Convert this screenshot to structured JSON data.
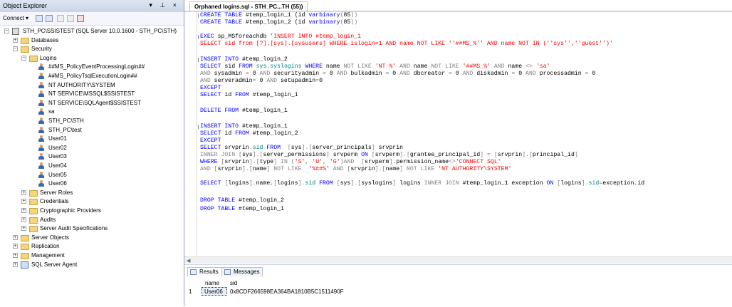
{
  "object_explorer": {
    "title": "Object Explorer",
    "title_buttons": "▾ ⊥ ×",
    "connect_label": "Connect ▾",
    "tree": [
      {
        "label": "STH_PC\\SSISTEST (SQL Server 10.0.1600 - STH_PC\\STH)",
        "icon": "server-icon",
        "expander": "−"
      },
      {
        "label": "Databases",
        "icon": "folder-icon",
        "expander": "+"
      },
      {
        "label": "Security",
        "icon": "folder-icon",
        "expander": "−"
      },
      {
        "label": "Logins",
        "icon": "folder-icon",
        "expander": "−"
      },
      {
        "label": "##MS_PolicyEventProcessingLogin##",
        "icon": "login-icon",
        "expander": ""
      },
      {
        "label": "##MS_PolicyTsqlExecutionLogin##",
        "icon": "login-icon",
        "expander": ""
      },
      {
        "label": "NT AUTHORITY\\SYSTEM",
        "icon": "login-icon",
        "expander": ""
      },
      {
        "label": "NT SERVICE\\MSSQL$SSISTEST",
        "icon": "login-icon",
        "expander": ""
      },
      {
        "label": "NT SERVICE\\SQLAgent$SSISTEST",
        "icon": "login-icon",
        "expander": ""
      },
      {
        "label": "sa",
        "icon": "login-icon",
        "expander": ""
      },
      {
        "label": "STH_PC\\STH",
        "icon": "login-icon",
        "expander": ""
      },
      {
        "label": "STH_PC\\test",
        "icon": "login-icon",
        "expander": ""
      },
      {
        "label": "User01",
        "icon": "login-icon",
        "expander": ""
      },
      {
        "label": "User02",
        "icon": "login-icon",
        "expander": ""
      },
      {
        "label": "User03",
        "icon": "login-icon",
        "expander": ""
      },
      {
        "label": "User04",
        "icon": "login-icon",
        "expander": ""
      },
      {
        "label": "User05",
        "icon": "login-icon",
        "expander": ""
      },
      {
        "label": "User06",
        "icon": "login-icon",
        "expander": ""
      },
      {
        "label": "Server Roles",
        "icon": "folder-icon",
        "expander": "+"
      },
      {
        "label": "Credentials",
        "icon": "folder-icon",
        "expander": "+"
      },
      {
        "label": "Cryptographic Providers",
        "icon": "folder-icon",
        "expander": "+"
      },
      {
        "label": "Audits",
        "icon": "folder-icon",
        "expander": "+"
      },
      {
        "label": "Server Audit Specifications",
        "icon": "folder-icon",
        "expander": "+"
      },
      {
        "label": "Server Objects",
        "icon": "folder-icon",
        "expander": "+"
      },
      {
        "label": "Replication",
        "icon": "folder-icon",
        "expander": "+"
      },
      {
        "label": "Management",
        "icon": "folder-icon",
        "expander": "+"
      },
      {
        "label": "SQL Server Agent",
        "icon": "agent-icon",
        "expander": "+"
      }
    ]
  },
  "editor": {
    "tab_title": "Orphaned logins.sql - STH_PC...TH (55))",
    "lines": [
      [
        [
          "k",
          "CREATE TABLE "
        ],
        [
          "",
          "#temp_login_1 (id "
        ],
        [
          "k",
          "varbinary"
        ],
        [
          "g",
          "("
        ],
        [
          "",
          "85"
        ],
        [
          "g",
          ")"
        ],
        [
          "g",
          ")"
        ]
      ],
      [
        [
          "k",
          "CREATE TABLE "
        ],
        [
          "",
          "#temp_login_2 (id "
        ],
        [
          "k",
          "varbinary"
        ],
        [
          "g",
          "("
        ],
        [
          "",
          "85"
        ],
        [
          "g",
          ")"
        ],
        [
          "g",
          ")"
        ]
      ],
      [],
      [
        [
          "k",
          "EXEC "
        ],
        [
          "",
          "sp_MSforeachdb "
        ],
        [
          "s",
          "'INSERT INTO #temp_login_1"
        ]
      ],
      [
        [
          "s",
          "SELECT sid from [?].[sys].[sysusers] WHERE islogin=1 AND name NOT LIKE ''##MS_%'' AND name NOT IN (''sys'',''guest'')'"
        ]
      ],
      [],
      [
        [
          "k",
          "INSERT INTO "
        ],
        [
          "",
          "#temp_login_2"
        ]
      ],
      [
        [
          "k",
          "SELECT "
        ],
        [
          "",
          "sid "
        ],
        [
          "k",
          "FROM "
        ],
        [
          "t",
          "sys.syslogins "
        ],
        [
          "k",
          "WHERE "
        ],
        [
          "",
          "name "
        ],
        [
          "g",
          "NOT LIKE "
        ],
        [
          "s",
          "'NT %' "
        ],
        [
          "g",
          "AND "
        ],
        [
          "",
          "name "
        ],
        [
          "g",
          "NOT LIKE "
        ],
        [
          "s",
          "'##MS_%' "
        ],
        [
          "g",
          "AND "
        ],
        [
          "",
          "name "
        ],
        [
          "g",
          "<> "
        ],
        [
          "s",
          "'sa'"
        ]
      ],
      [
        [
          "g",
          "AND "
        ],
        [
          "",
          "sysadmin "
        ],
        [
          "g",
          "= "
        ],
        [
          "",
          "0 "
        ],
        [
          "g",
          "AND "
        ],
        [
          "",
          "securityadmin "
        ],
        [
          "g",
          "= "
        ],
        [
          "",
          "0 "
        ],
        [
          "g",
          "AND "
        ],
        [
          "",
          "bulkadmin "
        ],
        [
          "g",
          "= "
        ],
        [
          "",
          "0 "
        ],
        [
          "g",
          "AND "
        ],
        [
          "",
          "dbcreator "
        ],
        [
          "g",
          "= "
        ],
        [
          "",
          "0 "
        ],
        [
          "g",
          "AND "
        ],
        [
          "",
          "diskadmin "
        ],
        [
          "g",
          "= "
        ],
        [
          "",
          "0 "
        ],
        [
          "g",
          "AND "
        ],
        [
          "",
          "processadmin "
        ],
        [
          "g",
          "= "
        ],
        [
          "",
          "0"
        ]
      ],
      [
        [
          "g",
          "AND "
        ],
        [
          "",
          "serveradmin"
        ],
        [
          "g",
          "= "
        ],
        [
          "",
          "0 "
        ],
        [
          "g",
          "AND "
        ],
        [
          "",
          "setupadmin"
        ],
        [
          "g",
          "="
        ],
        [
          "",
          "0"
        ]
      ],
      [
        [
          "k",
          "EXCEPT"
        ]
      ],
      [
        [
          "k",
          "SELECT "
        ],
        [
          "",
          "id "
        ],
        [
          "k",
          "FROM "
        ],
        [
          "",
          "#temp_login_1"
        ]
      ],
      [],
      [
        [
          "k",
          "DELETE FROM "
        ],
        [
          "",
          "#temp_login_1"
        ]
      ],
      [],
      [
        [
          "k",
          "INSERT INTO "
        ],
        [
          "",
          "#temp_login_1"
        ]
      ],
      [
        [
          "k",
          "SELECT "
        ],
        [
          "",
          "id "
        ],
        [
          "k",
          "FROM "
        ],
        [
          "",
          "#temp_login_2"
        ]
      ],
      [
        [
          "k",
          "EXCEPT"
        ]
      ],
      [
        [
          "k",
          "SELECT "
        ],
        [
          "",
          "srvprin"
        ],
        [
          "g",
          "."
        ],
        [
          "t",
          "sid "
        ],
        [
          "k",
          "FROM  "
        ],
        [
          "g",
          "["
        ],
        [
          "",
          "sys"
        ],
        [
          "g",
          "]."
        ],
        [
          "g",
          "["
        ],
        [
          "",
          "server_principals"
        ],
        [
          "g",
          "] "
        ],
        [
          "",
          "srvprin"
        ]
      ],
      [
        [
          "g",
          "INNER JOIN "
        ],
        [
          "g",
          "["
        ],
        [
          "",
          "sys"
        ],
        [
          "g",
          "]."
        ],
        [
          "g",
          "["
        ],
        [
          "",
          "server_permissions"
        ],
        [
          "g",
          "] "
        ],
        [
          "",
          "srvperm "
        ],
        [
          "k",
          "ON "
        ],
        [
          "g",
          "["
        ],
        [
          "",
          "srvperm"
        ],
        [
          "g",
          "]."
        ],
        [
          "g",
          "["
        ],
        [
          "",
          "grantee_principal_id"
        ],
        [
          "g",
          "] = ["
        ],
        [
          "",
          "srvprin"
        ],
        [
          "g",
          "]."
        ],
        [
          "g",
          "["
        ],
        [
          "",
          "principal_id"
        ],
        [
          "g",
          "]"
        ]
      ],
      [
        [
          "k",
          "WHERE "
        ],
        [
          "g",
          "["
        ],
        [
          "",
          "srvprin"
        ],
        [
          "g",
          "]."
        ],
        [
          "g",
          "["
        ],
        [
          "",
          "type"
        ],
        [
          "g",
          "] "
        ],
        [
          "g",
          "IN "
        ],
        [
          "g",
          "("
        ],
        [
          "s",
          "'S'"
        ],
        [
          "g",
          ", "
        ],
        [
          "s",
          "'U'"
        ],
        [
          "g",
          ", "
        ],
        [
          "s",
          "'G'"
        ],
        [
          "g",
          ")"
        ],
        [
          "g",
          "AND  "
        ],
        [
          "g",
          "["
        ],
        [
          "",
          "srvperm"
        ],
        [
          "g",
          "]."
        ],
        [
          "",
          "permission_name"
        ],
        [
          "g",
          "<>"
        ],
        [
          "s",
          "'CONNECT SQL'"
        ]
      ],
      [
        [
          "g",
          "AND "
        ],
        [
          "g",
          "["
        ],
        [
          "",
          "srvprin"
        ],
        [
          "g",
          "]."
        ],
        [
          "g",
          "["
        ],
        [
          "",
          "name"
        ],
        [
          "g",
          "] "
        ],
        [
          "g",
          "NOT LIKE  "
        ],
        [
          "s",
          "'%##%' "
        ],
        [
          "g",
          "AND "
        ],
        [
          "g",
          "["
        ],
        [
          "",
          "srvprin"
        ],
        [
          "g",
          "]."
        ],
        [
          "g",
          "["
        ],
        [
          "",
          "name"
        ],
        [
          "g",
          "] "
        ],
        [
          "g",
          "NOT LIKE "
        ],
        [
          "s",
          "'NT AUTHORITY\\SYSTEM'"
        ]
      ],
      [],
      [
        [
          "k",
          "SELECT "
        ],
        [
          "g",
          "["
        ],
        [
          "",
          "logins"
        ],
        [
          "g",
          "]."
        ],
        [
          "",
          "name"
        ],
        [
          "g",
          ","
        ],
        [
          "g",
          "["
        ],
        [
          "",
          "logins"
        ],
        [
          "g",
          "]."
        ],
        [
          "t",
          "sid "
        ],
        [
          "k",
          "FROM "
        ],
        [
          "g",
          "["
        ],
        [
          "",
          "sys"
        ],
        [
          "g",
          "]."
        ],
        [
          "g",
          "["
        ],
        [
          "",
          "syslogins"
        ],
        [
          "g",
          "] "
        ],
        [
          "",
          "logins "
        ],
        [
          "g",
          "INNER JOIN "
        ],
        [
          "",
          "#temp_login_1 exception "
        ],
        [
          "k",
          "ON "
        ],
        [
          "g",
          "["
        ],
        [
          "",
          "logins"
        ],
        [
          "g",
          "]."
        ],
        [
          "t",
          "sid"
        ],
        [
          "g",
          "="
        ],
        [
          "",
          "exception.id"
        ]
      ],
      [],
      [
        [
          "k",
          "DROP TABLE "
        ],
        [
          "",
          "#temp_login_2"
        ]
      ],
      [
        [
          "k",
          "DROP TABLE "
        ],
        [
          "",
          "#temp_login_1"
        ]
      ]
    ]
  },
  "results": {
    "tabs": [
      {
        "label": "Results",
        "active": true
      },
      {
        "label": "Messages",
        "active": false
      }
    ],
    "columns": [
      "name",
      "sid"
    ],
    "rows": [
      {
        "num": "1",
        "name": "User06",
        "sid": "0x8CDF266598EA364BA1810B5C1511490F"
      }
    ]
  },
  "colors": {
    "keyword": "#0000ff",
    "string": "#ff0000",
    "operator": "#808080",
    "system_object": "#008080"
  }
}
